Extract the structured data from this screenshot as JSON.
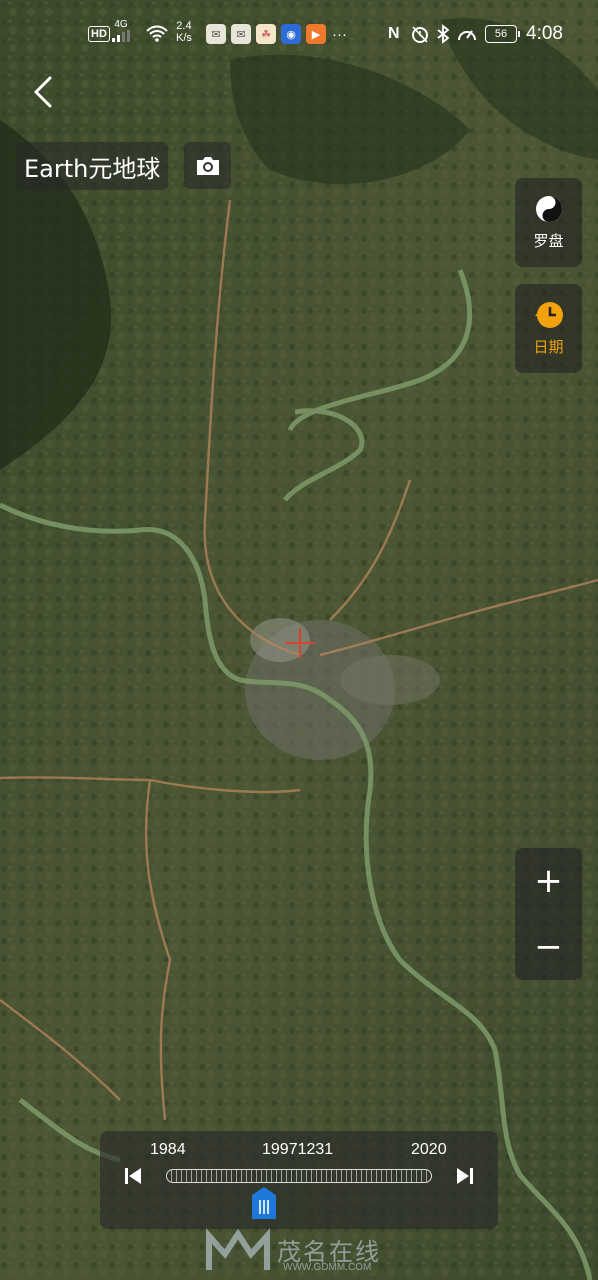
{
  "status_bar": {
    "hd": "HD",
    "network": "4G",
    "speed_value": "2.4",
    "speed_unit": "K/s",
    "more": "···",
    "battery": "56",
    "time": "4:08"
  },
  "app": {
    "title": "Earth元地球",
    "compass_label": "罗盘",
    "date_label": "日期"
  },
  "zoom": {
    "in": "+",
    "out": "−"
  },
  "timeline": {
    "start_year": "1984",
    "current_date": "19971231",
    "end_year": "2020",
    "position": 0.37
  },
  "watermark": {
    "text": "茂名在线",
    "url": "WWW.GDMM.COM"
  },
  "colors": {
    "accent_date": "#f2a20c",
    "thumb": "#1e78d8",
    "river": "#7d9a6a",
    "road": "#b9865d"
  }
}
